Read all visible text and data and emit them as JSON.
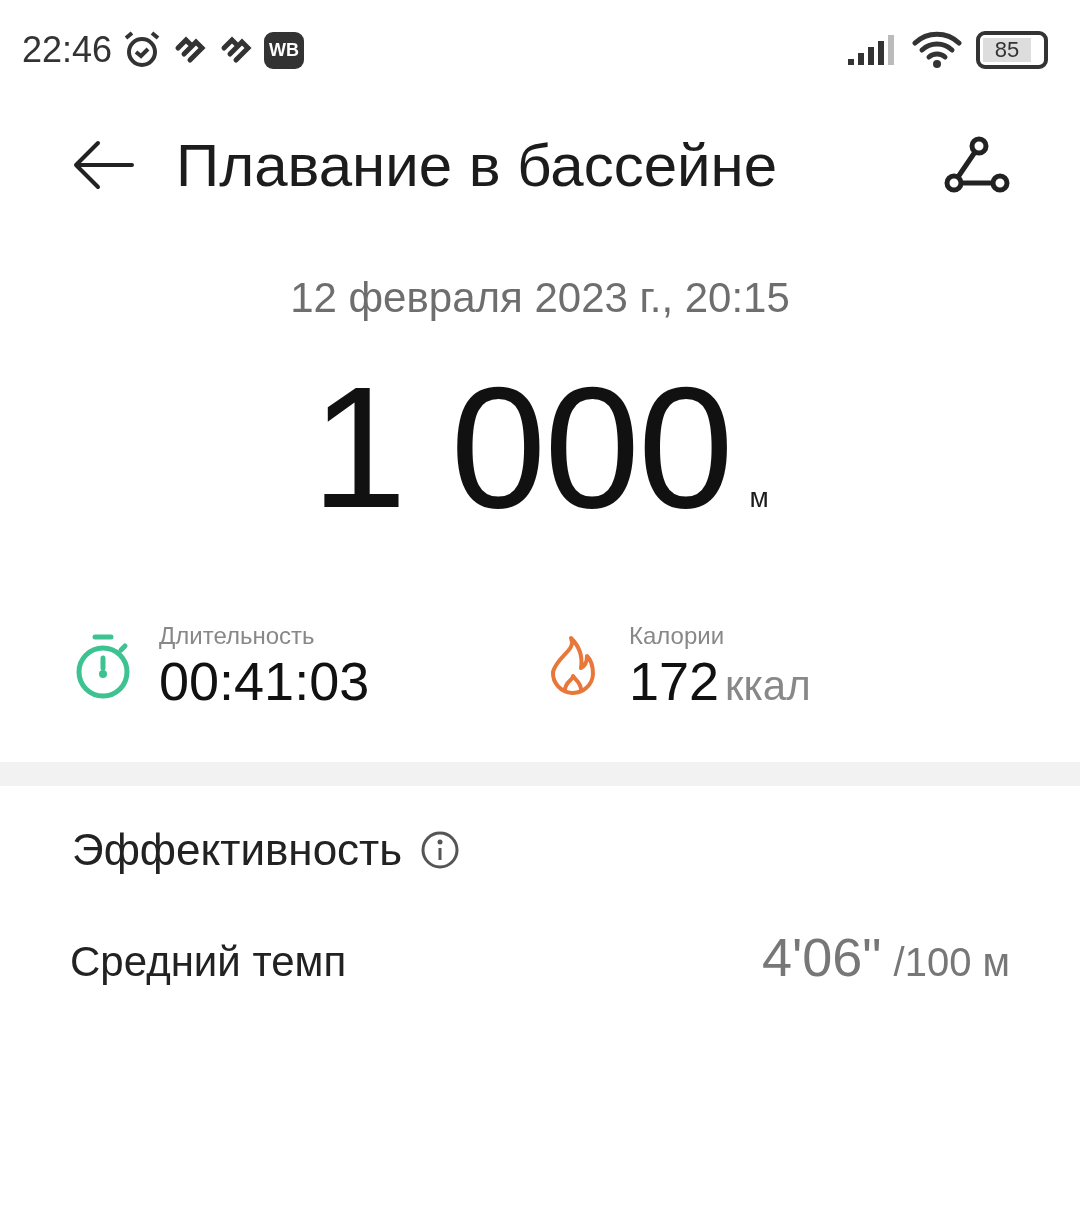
{
  "status_bar": {
    "time": "22:46",
    "badge": "WB",
    "battery": "85"
  },
  "header": {
    "title": "Плавание в бассейне"
  },
  "date": "12 февраля 2023 г., 20:15",
  "distance": {
    "value": "1 000",
    "unit": "м"
  },
  "stats": [
    {
      "kind": "duration",
      "label": "Длительность",
      "value": "00:41:03"
    },
    {
      "kind": "calories",
      "label": "Калории",
      "value": "172",
      "unit": "ккал"
    }
  ],
  "section": {
    "title": "Эффективность"
  },
  "rows": [
    {
      "label": "Средний темп",
      "value": "4'06\"",
      "unit": "/100 м"
    }
  ]
}
